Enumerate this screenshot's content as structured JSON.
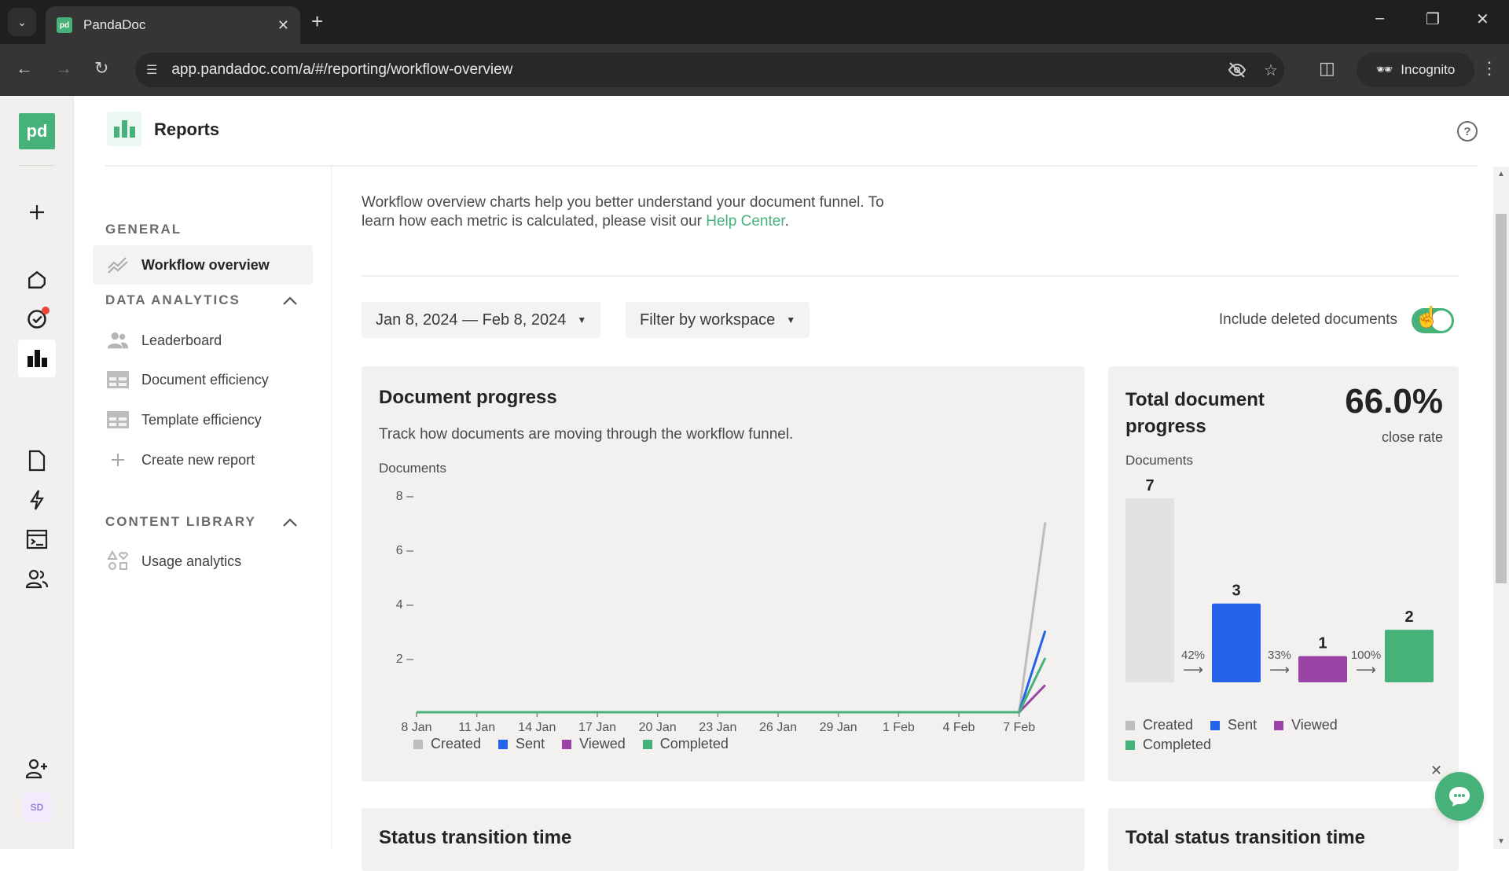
{
  "browser": {
    "tab_title": "PandaDoc",
    "url": "app.pandadoc.com/a/#/reporting/workflow-overview",
    "incognito_label": "Incognito"
  },
  "header": {
    "title": "Reports",
    "help_icon": "question-circle-icon"
  },
  "rail": {
    "logo": "pd",
    "avatar_initials": "SD"
  },
  "sidebar": {
    "general": {
      "heading": "GENERAL",
      "items": [
        {
          "label": "Workflow overview",
          "icon": "trend-lines-icon",
          "active": true
        }
      ]
    },
    "data_analytics": {
      "heading": "DATA ANALYTICS",
      "items": [
        {
          "label": "Leaderboard",
          "icon": "users-icon"
        },
        {
          "label": "Document efficiency",
          "icon": "table-icon"
        },
        {
          "label": "Template efficiency",
          "icon": "table-icon"
        },
        {
          "label": "Create new report",
          "icon": "plus-icon"
        }
      ]
    },
    "content_library": {
      "heading": "CONTENT LIBRARY",
      "items": [
        {
          "label": "Usage analytics",
          "icon": "shapes-icon"
        }
      ]
    }
  },
  "main": {
    "intro_text": "Workflow overview charts help you better understand your document funnel. To learn how each metric is calculated, please visit our ",
    "intro_link": "Help Center",
    "intro_end": ".",
    "date_range": "Jan 8, 2024 — Feb 8, 2024",
    "workspace_filter": "Filter by workspace",
    "toggle_label": "Include deleted documents",
    "toggle_on": true,
    "next_section_left": "Status transition time",
    "next_section_right": "Total status transition time"
  },
  "colors": {
    "brand": "#47b17a",
    "created": "#bdbdbd",
    "sent": "#2563eb",
    "viewed": "#9b44a8",
    "completed": "#47b17a"
  },
  "chart_data": [
    {
      "type": "line",
      "title": "Document progress",
      "subtitle": "Track how documents are moving through the workflow funnel.",
      "ylabel": "Documents",
      "xlabel": "",
      "ylim": [
        0,
        8
      ],
      "yticks": [
        2,
        4,
        6,
        8
      ],
      "xticks": [
        "8 Jan",
        "11 Jan",
        "14 Jan",
        "17 Jan",
        "20 Jan",
        "23 Jan",
        "26 Jan",
        "29 Jan",
        "1 Feb",
        "4 Feb",
        "7 Feb"
      ],
      "x_days": 31.5,
      "grid": false,
      "legend_position": "bottom-left",
      "series": [
        {
          "name": "Created",
          "color": "#bdbdbd",
          "points": [
            [
              0,
              0
            ],
            [
              30,
              0
            ],
            [
              31.3,
              7
            ]
          ]
        },
        {
          "name": "Sent",
          "color": "#2563eb",
          "points": [
            [
              0,
              0
            ],
            [
              30,
              0
            ],
            [
              31.3,
              3
            ]
          ]
        },
        {
          "name": "Viewed",
          "color": "#9b44a8",
          "points": [
            [
              0,
              0
            ],
            [
              30,
              0
            ],
            [
              31.3,
              1
            ]
          ]
        },
        {
          "name": "Completed",
          "color": "#47b17a",
          "points": [
            [
              0,
              0
            ],
            [
              30,
              0
            ],
            [
              31.3,
              2
            ]
          ]
        }
      ]
    },
    {
      "type": "bar",
      "title": "Total document progress",
      "headline_value": "66.0%",
      "headline_label": "close rate",
      "ylabel": "Documents",
      "categories": [
        "Created",
        "Sent",
        "Viewed",
        "Completed"
      ],
      "values": [
        7,
        3,
        1,
        2
      ],
      "colors": [
        "#e2e2e2",
        "#2563eb",
        "#9b44a8",
        "#47b17a"
      ],
      "legend_colors": [
        "#bdbdbd",
        "#2563eb",
        "#9b44a8",
        "#47b17a"
      ],
      "conversions": [
        "42%",
        "33%",
        "100%"
      ],
      "ylim": [
        0,
        7
      ],
      "legend_position": "bottom"
    }
  ]
}
